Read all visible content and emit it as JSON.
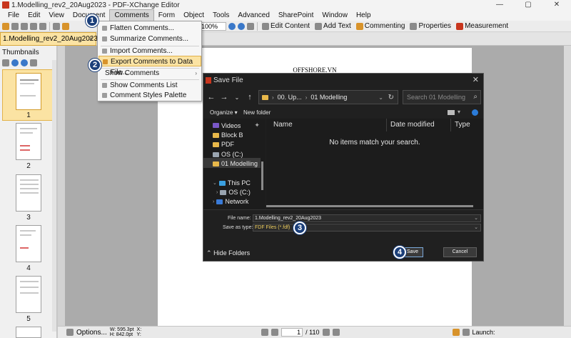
{
  "window": {
    "title": "1.Modelling_rev2_20Aug2023 - PDF-XChange Editor",
    "controls": [
      "—",
      "▢",
      "✕"
    ]
  },
  "menubar": {
    "items": [
      "File",
      "Edit",
      "View",
      "Document",
      "Comments",
      "Form",
      "Object",
      "Tools",
      "Advanced",
      "SharePoint",
      "Window",
      "Help"
    ],
    "active": "Comments"
  },
  "toolbar": {
    "zoom": "100%",
    "buttons": {
      "edit_content": "Edit Content",
      "add_text": "Add Text",
      "commenting": "Commenting",
      "properties": "Properties",
      "measurement": "Measurement"
    }
  },
  "document_tab": {
    "label": "1.Modelling_rev2_20Aug2023",
    "close": "×"
  },
  "sidebar": {
    "title": "Thumbnails",
    "pages": [
      "1",
      "2",
      "3",
      "4",
      "5"
    ],
    "selected_page": "1"
  },
  "page": {
    "header_text": "OFFSHORE.VN"
  },
  "statusbar": {
    "options_label": "Options...",
    "width": "W: 595.3pt",
    "height": "H: 842.0pt",
    "x_label": "X:",
    "y_label": "Y:",
    "current_page": "1",
    "total_pages": "/ 110",
    "launch_label": "Launch:"
  },
  "comments_menu": {
    "items": [
      {
        "label": "Flatten Comments..."
      },
      {
        "label": "Summarize Comments..."
      },
      {
        "label": "Import Comments..."
      },
      {
        "label": "Export Comments to Data File...",
        "highlighted": true
      },
      {
        "label": "Show Comments",
        "submenu": true
      },
      {
        "label": "Show Comments List"
      },
      {
        "label": "Comment Styles Palette"
      }
    ]
  },
  "save_dialog": {
    "title": "Save File",
    "close": "✕",
    "address": {
      "crumb1": "00. Up...",
      "crumb2": "01 Modelling"
    },
    "search_placeholder": "Search 01 Modelling",
    "commands": {
      "organize": "Organize ▾",
      "new_folder": "New folder"
    },
    "nav_items": {
      "videos": "Videos",
      "block_b": "Block B",
      "pdf": "PDF",
      "os_c": "OS (C:)",
      "modelling": "01 Modelling",
      "this_pc": "This PC",
      "os_c_2": "OS (C:)",
      "network": "Network"
    },
    "columns": {
      "name": "Name",
      "date_modified": "Date modified",
      "type": "Type"
    },
    "empty_message": "No items match your search.",
    "file_name_label": "File name:",
    "file_name_value": "1.Modelling_rev2_20Aug2023",
    "save_type_label": "Save as type:",
    "save_type_value": "FDF Files (*.fdf)",
    "hide_folders": "Hide Folders",
    "save_button": "Save",
    "cancel_button": "Cancel"
  },
  "callouts": [
    "1",
    "2",
    "3",
    "4"
  ]
}
